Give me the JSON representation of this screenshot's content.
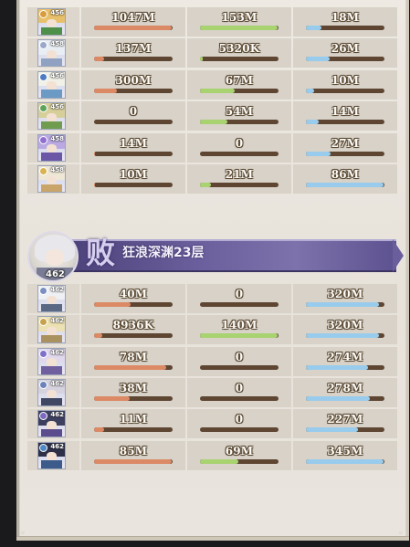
{
  "team1": {
    "rows": [
      {
        "level": "456",
        "damage": "1047M",
        "damage_pct": 0.99,
        "tank": "153M",
        "tank_pct": 0.99,
        "heal": "18M",
        "heal_pct": 0.2,
        "hair": "#e8c06a",
        "body": "#4e8f4a",
        "elem": "#d89c3a"
      },
      {
        "level": "458",
        "damage": "137M",
        "damage_pct": 0.13,
        "tank": "5320K",
        "tank_pct": 0.03,
        "heal": "26M",
        "heal_pct": 0.3,
        "hair": "#e9eef4",
        "body": "#8fa2c2",
        "elem": "#9aa9c9"
      },
      {
        "level": "456",
        "damage": "300M",
        "damage_pct": 0.29,
        "tank": "67M",
        "tank_pct": 0.44,
        "heal": "10M",
        "heal_pct": 0.11,
        "hair": "#f1f1e8",
        "body": "#6b9bc5",
        "elem": "#4e7bc2"
      },
      {
        "level": "456",
        "damage": "0",
        "damage_pct": 0,
        "tank": "54M",
        "tank_pct": 0.35,
        "heal": "14M",
        "heal_pct": 0.16,
        "hair": "#d7cf9a",
        "body": "#6f9c4e",
        "elem": "#5fa35a"
      },
      {
        "level": "458",
        "damage": "14M",
        "damage_pct": 0.01,
        "tank": "0",
        "tank_pct": 0,
        "heal": "27M",
        "heal_pct": 0.31,
        "hair": "#b9a8e2",
        "body": "#6b57a6",
        "elem": "#8f6ed0"
      },
      {
        "level": "458",
        "damage": "10M",
        "damage_pct": 0.01,
        "tank": "21M",
        "tank_pct": 0.14,
        "heal": "86M",
        "heal_pct": 0.99,
        "hair": "#efe7d6",
        "body": "#c9a56a",
        "elem": "#d9b251"
      }
    ]
  },
  "banner": {
    "result": "败",
    "stage": "狂浪深渊23层",
    "level": "462"
  },
  "team2": {
    "rows": [
      {
        "level": "462",
        "damage": "40M",
        "damage_pct": 0.47,
        "tank": "0",
        "tank_pct": 0,
        "heal": "320M",
        "heal_pct": 0.93,
        "hair": "#eef0f4",
        "body": "#5a6884",
        "elem": "#7a8fbf"
      },
      {
        "level": "462",
        "damage": "8936K",
        "damage_pct": 0.1,
        "tank": "140M",
        "tank_pct": 0.99,
        "heal": "320M",
        "heal_pct": 0.93,
        "hair": "#ece1b2",
        "body": "#aa9260",
        "elem": "#c7a24c"
      },
      {
        "level": "462",
        "damage": "78M",
        "damage_pct": 0.92,
        "tank": "0",
        "tank_pct": 0,
        "heal": "274M",
        "heal_pct": 0.79,
        "hair": "#e0d8ec",
        "body": "#6f5f9e",
        "elem": "#7e6fc9"
      },
      {
        "level": "462",
        "damage": "38M",
        "damage_pct": 0.45,
        "tank": "0",
        "tank_pct": 0,
        "heal": "278M",
        "heal_pct": 0.81,
        "hair": "#d6d2de",
        "body": "#3f4763",
        "elem": "#6c82b8"
      },
      {
        "level": "462",
        "damage": "11M",
        "damage_pct": 0.13,
        "tank": "0",
        "tank_pct": 0,
        "heal": "227M",
        "heal_pct": 0.66,
        "hair": "#3c3f5e",
        "body": "#5b4c8e",
        "elem": "#7d6ac0"
      },
      {
        "level": "462",
        "damage": "85M",
        "damage_pct": 0.99,
        "tank": "69M",
        "tank_pct": 0.49,
        "heal": "345M",
        "heal_pct": 0.99,
        "hair": "#2d3047",
        "body": "#3c5a8a",
        "elem": "#4f88c6"
      }
    ]
  }
}
